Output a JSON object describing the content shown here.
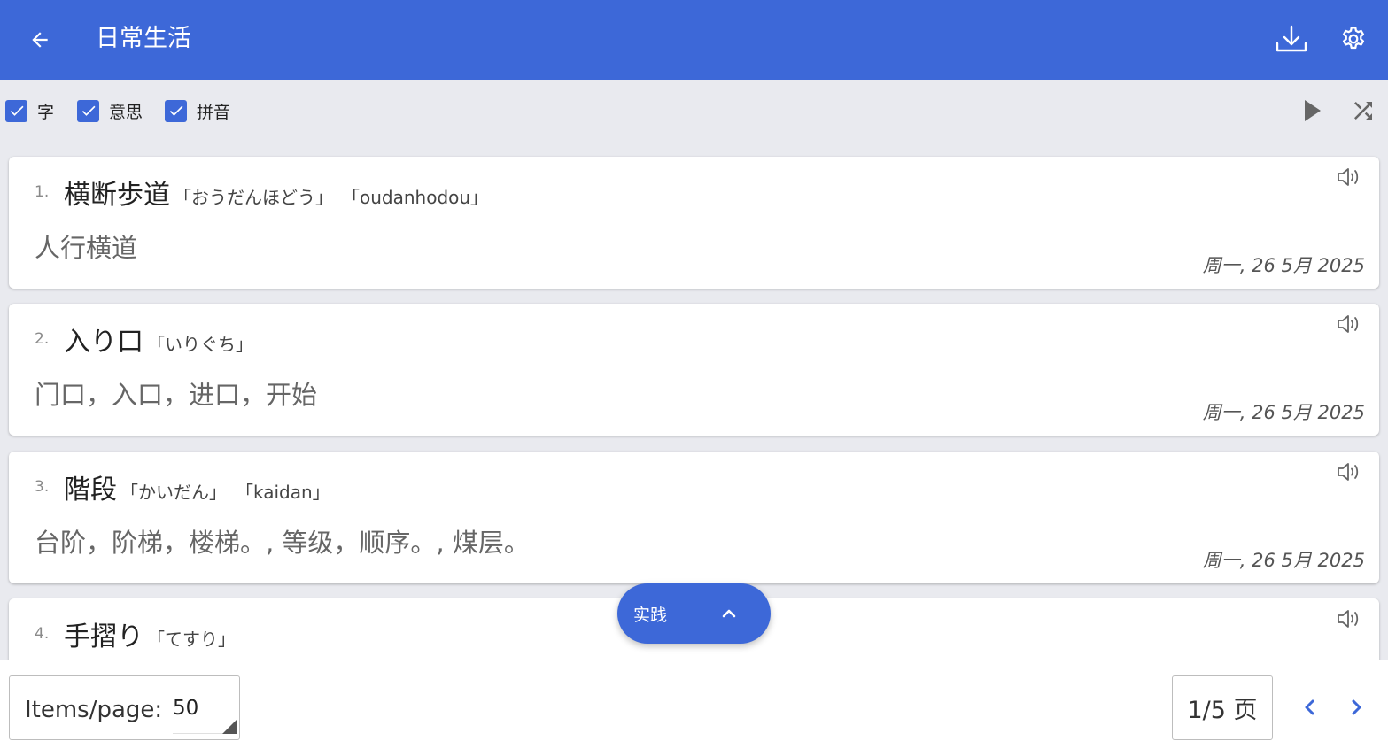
{
  "colors": {
    "primary": "#3d68d8",
    "background": "#e9eaef",
    "card": "#ffffff"
  },
  "appbar": {
    "title": "日常生活",
    "back_icon": "arrow-left-icon",
    "download_icon": "download-icon",
    "settings_icon": "gear-icon"
  },
  "filters": [
    {
      "label": "字",
      "checked": true
    },
    {
      "label": "意思",
      "checked": true
    },
    {
      "label": "拼音",
      "checked": true
    }
  ],
  "toolbar": {
    "play_icon": "play-icon",
    "shuffle_icon": "shuffle-icon"
  },
  "cards": [
    {
      "number": "1.",
      "word": "横断歩道",
      "reading": "「おうだんほどう」",
      "romaji": "「oudanhodou」",
      "meaning": "人行横道",
      "date": "周一, 26 5月 2025"
    },
    {
      "number": "2.",
      "word": "入り口",
      "reading": "「いりぐち」",
      "romaji": "",
      "meaning": "门口，入口，进口，开始",
      "date": "周一, 26 5月 2025"
    },
    {
      "number": "3.",
      "word": "階段",
      "reading": "「かいだん」",
      "romaji": "「kaidan」",
      "meaning": "台阶，阶梯，楼梯。, 等级，顺序。, 煤层。",
      "date": "周一, 26 5月 2025"
    },
    {
      "number": "4.",
      "word": "手摺り",
      "reading": "「てすり」",
      "romaji": "",
      "meaning": "",
      "date": ""
    }
  ],
  "fab": {
    "label": "实践",
    "icon": "chevron-up-icon"
  },
  "pagination": {
    "items_label": "Items/page:",
    "items_value": "50",
    "page_label": "1/5 页",
    "prev_icon": "chevron-left-icon",
    "next_icon": "chevron-right-icon"
  }
}
